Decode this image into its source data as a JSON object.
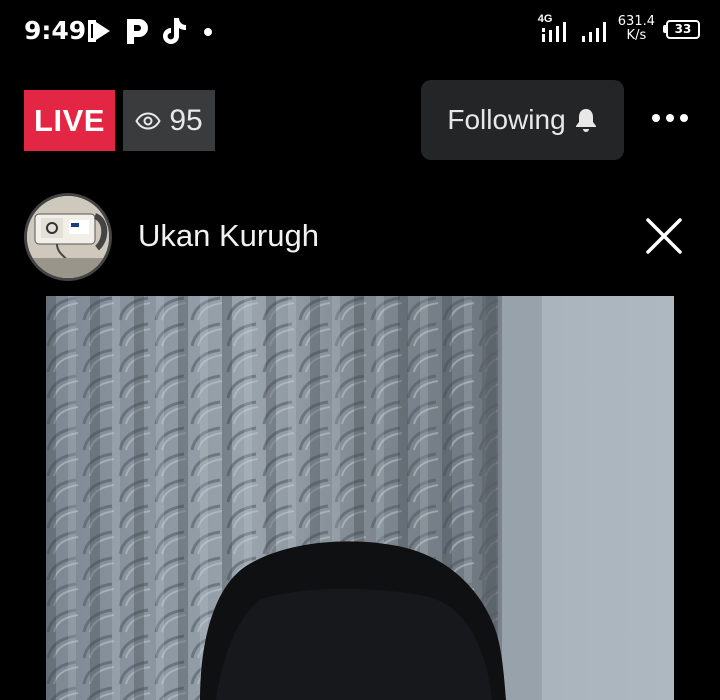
{
  "status_bar": {
    "time": "9:49",
    "app_icons": [
      "bluesky-like-icon",
      "p-icon",
      "tiktok-icon",
      "dot-icon"
    ],
    "network_type": "4G",
    "speed_value": "631.4",
    "speed_unit": "K/s",
    "battery": "33"
  },
  "header": {
    "live_label": "LIVE",
    "viewer_count": "95",
    "following_label": "Following"
  },
  "author": {
    "name": "Ukan Kurugh"
  },
  "colors": {
    "live_red": "#e42645",
    "viewer_badge_bg": "#3a3b3d",
    "following_bg": "#242526"
  }
}
